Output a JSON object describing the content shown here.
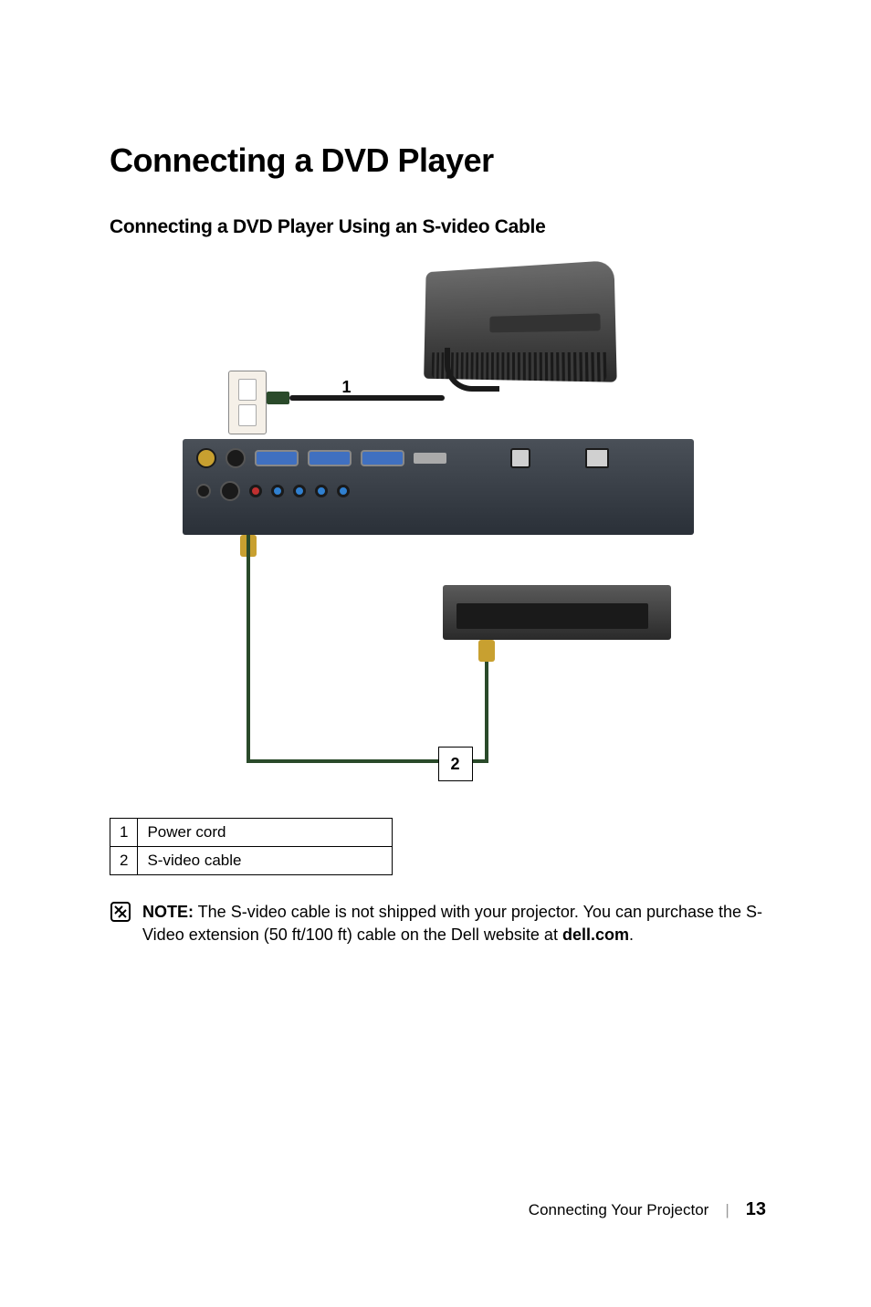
{
  "title": "Connecting a DVD Player",
  "subtitle": "Connecting a DVD Player Using an S-video Cable",
  "figure": {
    "callout1": "1",
    "callout2": "2"
  },
  "legend": [
    {
      "num": "1",
      "label": "Power cord"
    },
    {
      "num": "2",
      "label": "S-video cable"
    }
  ],
  "note": {
    "prefix": "NOTE:",
    "body": " The S-video cable is not shipped with your projector. You can purchase the S-Video extension (50 ft/100 ft) cable on the Dell website at ",
    "link": "dell.com",
    "suffix": "."
  },
  "footer": {
    "section": "Connecting Your Projector",
    "page": "13"
  }
}
